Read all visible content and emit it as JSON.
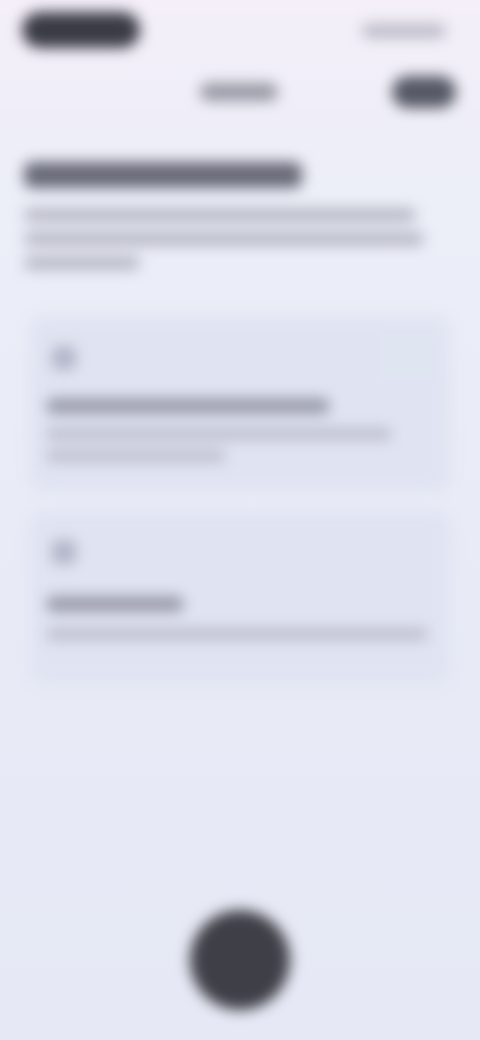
{
  "status_bar": {
    "left_pill": "",
    "right_indicators": ""
  },
  "header": {
    "title": "",
    "action_label": ""
  },
  "section": {
    "heading": "",
    "description": ""
  },
  "cards": [
    {
      "icon": "info-icon",
      "title": "",
      "body": ""
    },
    {
      "icon": "info-icon",
      "title": "",
      "body": ""
    }
  ],
  "fab": {
    "label": ""
  },
  "colors": {
    "background_top": "#f4eff8",
    "background_bottom": "#e6e9f5",
    "card": "#dfe3f1",
    "dark_control": "#3f3f47"
  }
}
